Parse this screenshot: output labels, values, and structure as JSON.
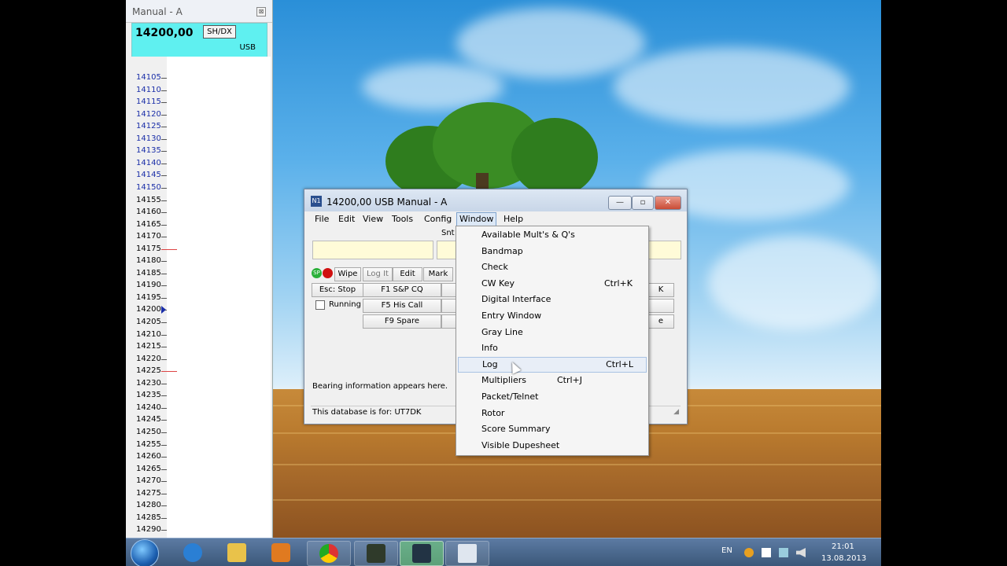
{
  "bandmap": {
    "title": "Manual - A",
    "close_symbol": "⊠",
    "frequency": "14200,00",
    "shdx_label": "SH/DX",
    "mode": "USB",
    "ticks": [
      "14105",
      "14110",
      "14115",
      "14120",
      "14125",
      "14130",
      "14135",
      "14140",
      "14145",
      "14150",
      "14155",
      "14160",
      "14165",
      "14170",
      "14175",
      "14180",
      "14185",
      "14190",
      "14195",
      "14200",
      "14205",
      "14210",
      "14215",
      "14220",
      "14225",
      "14230",
      "14235",
      "14240",
      "14245",
      "14250",
      "14255",
      "14260",
      "14265",
      "14270",
      "14275",
      "14280",
      "14285",
      "14290"
    ],
    "blue_ticks_until": "14150",
    "marker_ticks": [
      "14175",
      "14225"
    ],
    "current_tick": "14200"
  },
  "main_window": {
    "title": "14200,00 USB Manual - A",
    "app_icon_label": "N1",
    "minimize": "—",
    "restore": "▫",
    "close": "✕",
    "menu": [
      "File",
      "Edit",
      "View",
      "Tools",
      "Config",
      "Window",
      "Help"
    ],
    "active_menu": "Window",
    "snt_label": "Snt",
    "buttons": {
      "wipe": "Wipe",
      "log_it": "Log It",
      "edit": "Edit",
      "mark": "Mark",
      "esc_stop": "Esc: Stop",
      "f1": "F1 S&P CQ",
      "f5": "F5 His Call",
      "f9": "F9 Spare",
      "right1": "K",
      "right3": "e"
    },
    "running_label": "Running",
    "bearing_text": "Bearing information appears here.",
    "status_text": "This database is for: UT7DK"
  },
  "window_menu": [
    {
      "label": "Available Mult's & Q's",
      "shortcut": ""
    },
    {
      "label": "Bandmap",
      "shortcut": ""
    },
    {
      "label": "Check",
      "shortcut": ""
    },
    {
      "label": "CW Key",
      "shortcut": "Ctrl+K"
    },
    {
      "label": "Digital Interface",
      "shortcut": ""
    },
    {
      "label": "Entry Window",
      "shortcut": ""
    },
    {
      "label": "Gray Line",
      "shortcut": ""
    },
    {
      "label": "Info",
      "shortcut": ""
    },
    {
      "label": "Log",
      "shortcut": "Ctrl+L"
    },
    {
      "label": "Multipliers",
      "shortcut": "Ctrl+J"
    },
    {
      "label": "Packet/Telnet",
      "shortcut": ""
    },
    {
      "label": "Rotor",
      "shortcut": ""
    },
    {
      "label": "Score Summary",
      "shortcut": ""
    },
    {
      "label": "Visible Dupesheet",
      "shortcut": ""
    }
  ],
  "highlighted_menu_item": "Log",
  "taskbar": {
    "language": "EN",
    "time": "21:01",
    "date": "13.08.2013"
  },
  "colors": {
    "freq_box": "#5ff0f0",
    "entry_bg": "#fffbd8",
    "taskbar": "#3a5678"
  }
}
